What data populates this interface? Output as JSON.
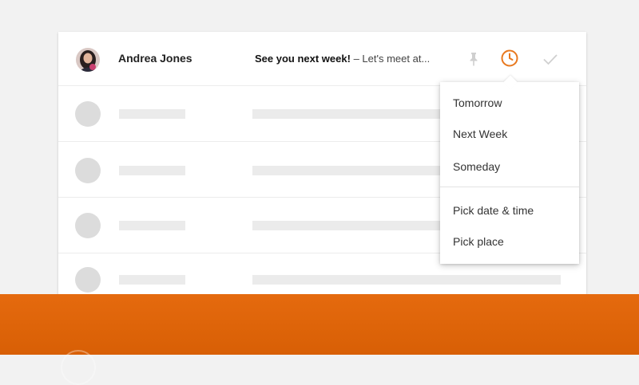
{
  "email": {
    "sender": "Andrea Jones",
    "subject": "See you next week!",
    "separator": " – ",
    "preview": "Let's meet at..."
  },
  "row_actions": {
    "pin_icon": "pin-icon",
    "snooze_icon": "clock-icon",
    "done_icon": "check-icon",
    "accent_color": "#e8791f"
  },
  "snooze_menu": {
    "items": [
      "Tomorrow",
      "Next Week",
      "Someday",
      "Pick date & time",
      "Pick place"
    ]
  },
  "colors": {
    "background": "#f2f2f2",
    "banner": "#e06508",
    "placeholder": "#ebebeb"
  }
}
